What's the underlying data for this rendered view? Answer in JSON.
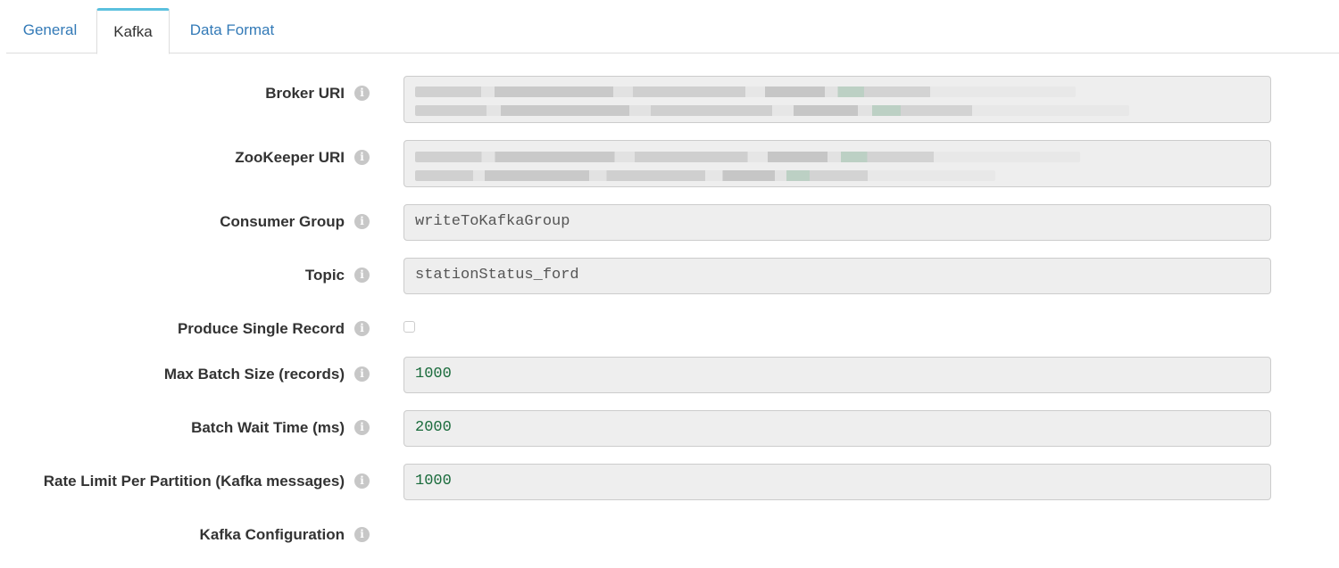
{
  "tabs": [
    {
      "label": "General"
    },
    {
      "label": "Kafka"
    },
    {
      "label": "Data Format"
    }
  ],
  "form": {
    "broker_uri": {
      "label": "Broker URI"
    },
    "zookeeper_uri": {
      "label": "ZooKeeper URI"
    },
    "consumer_group": {
      "label": "Consumer Group",
      "value": "writeToKafkaGroup"
    },
    "topic": {
      "label": "Topic",
      "value": "stationStatus_ford"
    },
    "produce_single_record": {
      "label": "Produce Single Record",
      "checked": false
    },
    "max_batch_size": {
      "label": "Max Batch Size (records)",
      "value": "1000"
    },
    "batch_wait_time": {
      "label": "Batch Wait Time (ms)",
      "value": "2000"
    },
    "rate_limit": {
      "label": "Rate Limit Per Partition (Kafka messages)",
      "value": "1000"
    },
    "kafka_configuration": {
      "label": "Kafka Configuration"
    }
  },
  "icons": {
    "info": "info-icon"
  },
  "colors": {
    "accent_tab": "#5bc0de",
    "link": "#337ab7",
    "number_text": "#1a6b3c"
  }
}
